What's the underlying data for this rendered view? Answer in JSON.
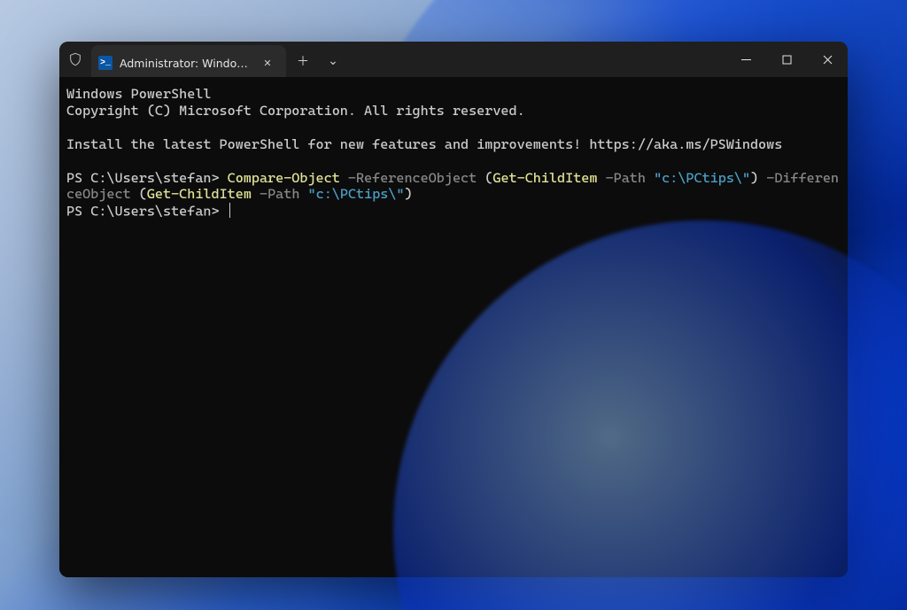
{
  "titlebar": {
    "tab_label": "Administrator: Windows Powe",
    "ps_icon_glyph": ">_",
    "close_tab_glyph": "✕",
    "new_tab_glyph": "＋",
    "dropdown_glyph": "⌄"
  },
  "window_controls": {
    "minimize_label": "Minimize",
    "maximize_label": "Maximize",
    "close_label": "Close"
  },
  "terminal": {
    "line1": "Windows PowerShell",
    "line2": "Copyright (C) Microsoft Corporation. All rights reserved.",
    "blank1": "",
    "line3": "Install the latest PowerShell for new features and improvements! https://aka.ms/PSWindows",
    "blank2": "",
    "prompt1": "PS C:\\Users\\stefan> ",
    "cmd1_compare": "Compare-Object",
    "cmd1_sp1": " ",
    "cmd1_refparam": "-ReferenceObject",
    "cmd1_sp2": " ",
    "cmd1_open1": "(",
    "cmd1_gci1": "Get-ChildItem",
    "cmd1_sp3": " ",
    "cmd1_pathparam1": "-Path",
    "cmd1_sp4": " ",
    "cmd1_str1": "\"c:\\PCtips\\\"",
    "cmd1_close1": ")",
    "cmd1_sp5": " ",
    "cmd1_diffparam_a": "-Diffe",
    "cmd1_diffparam_b": "renceObject",
    "cmd1_sp6": " ",
    "cmd1_open2": "(",
    "cmd1_gci2": "Get-ChildItem",
    "cmd1_sp7": " ",
    "cmd1_pathparam2": "-Path",
    "cmd1_sp8": " ",
    "cmd1_str2": "\"c:\\PCtips\\\"",
    "cmd1_close2": ")",
    "prompt2": "PS C:\\Users\\stefan> "
  }
}
